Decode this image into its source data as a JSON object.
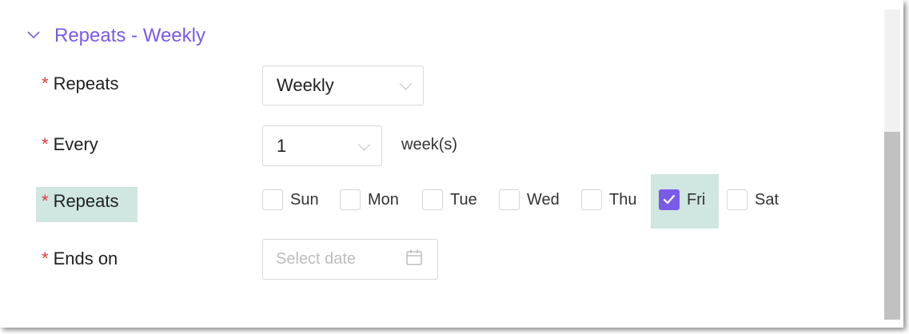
{
  "section": {
    "title": "Repeats - Weekly",
    "chevron_icon": "chevron-down-icon",
    "accent_color": "#7a5be8"
  },
  "fields": {
    "repeats": {
      "required_mark": "*",
      "label": "Repeats",
      "value": "Weekly"
    },
    "every": {
      "required_mark": "*",
      "label": "Every",
      "value": "1",
      "unit": "week(s)"
    },
    "repeat_days": {
      "required_mark": "*",
      "label": "Repeats",
      "days": [
        {
          "label": "Sun",
          "checked": false
        },
        {
          "label": "Mon",
          "checked": false
        },
        {
          "label": "Tue",
          "checked": false
        },
        {
          "label": "Wed",
          "checked": false
        },
        {
          "label": "Thu",
          "checked": false
        },
        {
          "label": "Fri",
          "checked": true
        },
        {
          "label": "Sat",
          "checked": false
        }
      ]
    },
    "ends_on": {
      "required_mark": "*",
      "label": "Ends on",
      "placeholder": "Select date",
      "icon": "calendar-icon"
    }
  },
  "colors": {
    "required": "#e53935",
    "highlight": "#cfe6e1",
    "checkbox_checked": "#7a5be8"
  }
}
